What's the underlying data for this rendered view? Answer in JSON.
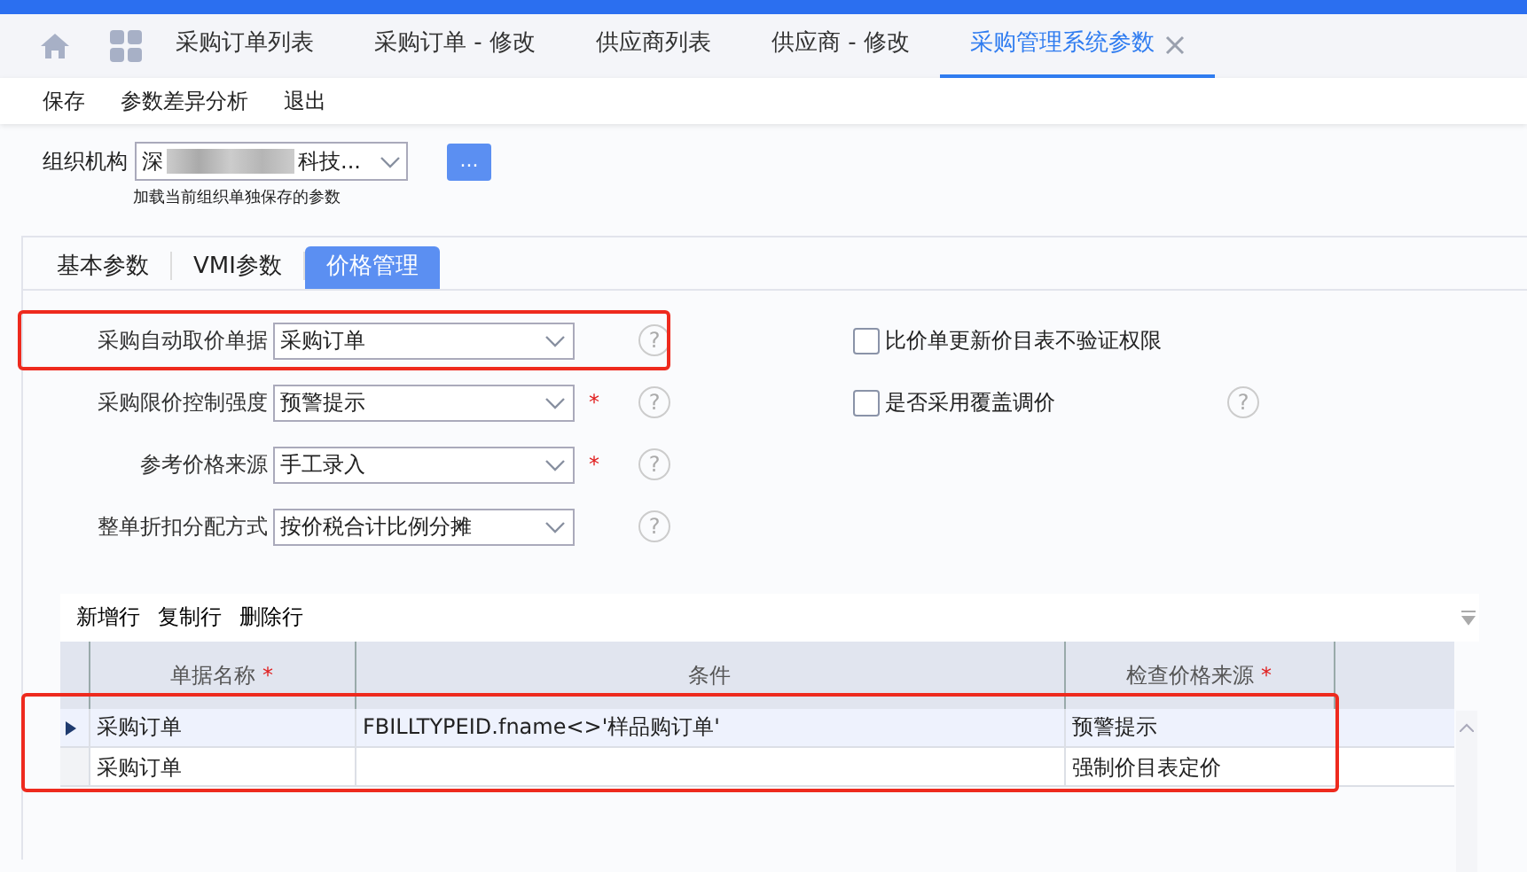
{
  "top_tabs": [
    {
      "label": "采购订单列表",
      "selected": false
    },
    {
      "label": "采购订单 - 修改",
      "selected": false
    },
    {
      "label": "供应商列表",
      "selected": false
    },
    {
      "label": "供应商 - 修改",
      "selected": false
    },
    {
      "label": "采购管理系统参数",
      "selected": true
    }
  ],
  "toolbar": [
    "保存",
    "参数差异分析",
    "退出"
  ],
  "org": {
    "label": "组织机构",
    "value_start": "深",
    "value_end": "科技...",
    "button": "...",
    "note": "加载当前组织单独保存的参数"
  },
  "param_tabs": [
    {
      "label": "基本参数",
      "selected": false
    },
    {
      "label": "VMI参数",
      "selected": false
    },
    {
      "label": "价格管理",
      "selected": true
    }
  ],
  "fields": [
    {
      "label": "采购自动取价单据",
      "value": "采购订单",
      "help": "?",
      "highlighted": true
    },
    {
      "label": "采购限价控制强度",
      "value": "预警提示",
      "required_mark": "*",
      "help": "?",
      "highlighted": false
    },
    {
      "label": "参考价格来源",
      "value": "手工录入",
      "required_mark": "*",
      "help": "?",
      "highlighted": false
    },
    {
      "label": "整单折扣分配方式",
      "value": "按价税合计比例分摊",
      "help": "?",
      "highlighted": false
    }
  ],
  "checkboxes": [
    {
      "label": "比价单更新价目表不验证权限",
      "checked": false
    },
    {
      "label": "是否采用覆盖调价",
      "checked": false,
      "help": "?"
    }
  ],
  "grid": {
    "actions": [
      "新增行",
      "复制行",
      "删除行"
    ],
    "highlighted": true,
    "columns": [
      {
        "label": "单据名称",
        "required_mark": "*"
      },
      {
        "label": "条件"
      },
      {
        "label": "检查价格来源",
        "required_mark": "*"
      }
    ],
    "rows": [
      {
        "selected": true,
        "bill": "采购订单",
        "condition": "FBILLTYPEID.fname<>'样品购订单'",
        "source": "预警提示"
      },
      {
        "selected": false,
        "bill": "采购订单",
        "source": "强制价目表定价"
      }
    ]
  }
}
